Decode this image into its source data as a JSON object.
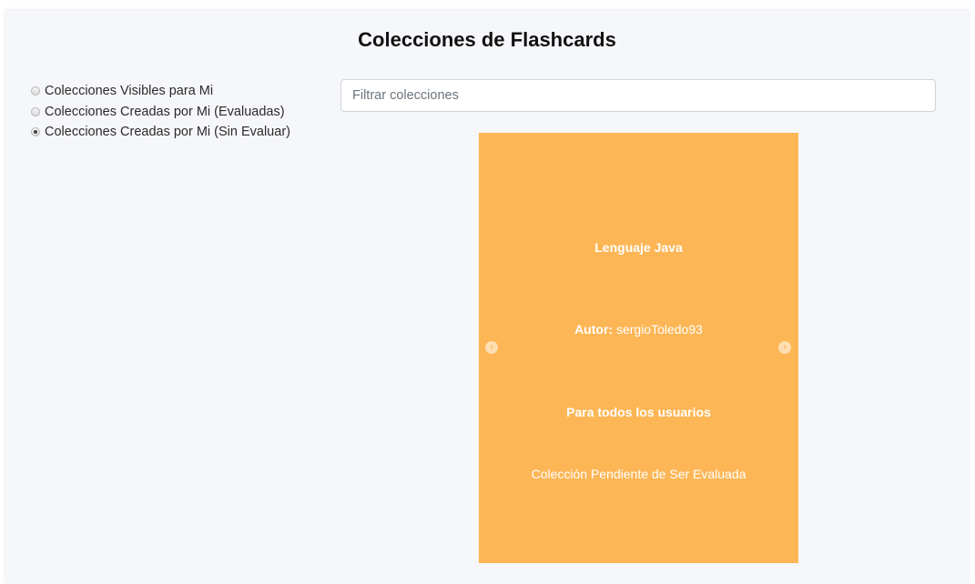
{
  "page": {
    "title": "Colecciones de Flashcards"
  },
  "filters": {
    "options": [
      {
        "label": "Colecciones Visibles para Mi",
        "checked": false
      },
      {
        "label": "Colecciones Creadas por Mi (Evaluadas)",
        "checked": false
      },
      {
        "label": "Colecciones Creadas por Mi (Sin Evaluar)",
        "checked": true
      }
    ]
  },
  "search": {
    "placeholder": "Filtrar colecciones",
    "value": ""
  },
  "card": {
    "title": "Lenguaje Java",
    "author_label": "Autor:",
    "author": "sergioToledo93",
    "visibility": "Para todos los usuarios",
    "status": "Colección Pendiente de Ser Evaluada",
    "background_color": "#fdb655",
    "prev_icon": "arrow-left-circle-icon",
    "next_icon": "arrow-right-circle-icon"
  }
}
